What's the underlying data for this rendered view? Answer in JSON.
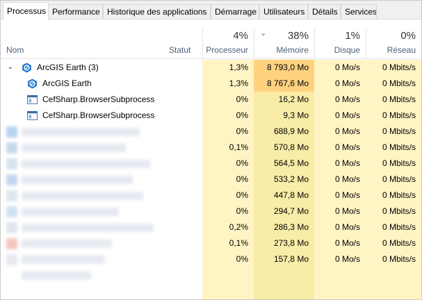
{
  "tabs": [
    {
      "label": "Processus",
      "active": true
    },
    {
      "label": "Performance",
      "active": false
    },
    {
      "label": "Historique des applications",
      "active": false
    },
    {
      "label": "Démarrage",
      "active": false
    },
    {
      "label": "Utilisateurs",
      "active": false
    },
    {
      "label": "Détails",
      "active": false
    },
    {
      "label": "Services",
      "active": false
    }
  ],
  "columns": {
    "name": {
      "label": "Nom"
    },
    "status": {
      "label": "Statut"
    },
    "cpu": {
      "label": "Processeur",
      "total": "4%"
    },
    "memory": {
      "label": "Mémoire",
      "total": "38%",
      "sorted": true
    },
    "disk": {
      "label": "Disque",
      "total": "1%"
    },
    "network": {
      "label": "Réseau",
      "total": "0%"
    }
  },
  "colors": {
    "heat_light": "#fff4c4",
    "heat_medium": "#f9eca8",
    "heat_strong": "#ffd280",
    "header_label": "#4c607a",
    "arcgis_blue": "#1f77d0"
  },
  "rows": [
    {
      "name": "ArcGIS Earth (3)",
      "group": true,
      "expanded": true,
      "icon": "arcgis-earth-icon",
      "cpu": "1,3%",
      "memory": "8 793,0 Mo",
      "disk": "0 Mo/s",
      "network": "0 Mbits/s"
    },
    {
      "name": "ArcGIS Earth",
      "child": true,
      "icon": "arcgis-earth-icon",
      "cpu": "1,3%",
      "memory": "8 767,6 Mo",
      "disk": "0 Mo/s",
      "network": "0 Mbits/s"
    },
    {
      "name": "CefSharp.BrowserSubprocess",
      "child": true,
      "icon": "window-app-icon",
      "cpu": "0%",
      "memory": "16,2 Mo",
      "disk": "0 Mo/s",
      "network": "0 Mbits/s"
    },
    {
      "name": "CefSharp.BrowserSubprocess",
      "child": true,
      "icon": "window-app-icon",
      "cpu": "0%",
      "memory": "9,3 Mo",
      "disk": "0 Mo/s",
      "network": "0 Mbits/s"
    },
    {
      "name": "",
      "blurred": true,
      "cpu": "0%",
      "memory": "688,9 Mo",
      "disk": "0 Mo/s",
      "network": "0 Mbits/s"
    },
    {
      "name": "",
      "blurred": true,
      "cpu": "0,1%",
      "memory": "570,8 Mo",
      "disk": "0 Mo/s",
      "network": "0 Mbits/s"
    },
    {
      "name": "",
      "blurred": true,
      "cpu": "0%",
      "memory": "564,5 Mo",
      "disk": "0 Mo/s",
      "network": "0 Mbits/s"
    },
    {
      "name": "",
      "blurred": true,
      "cpu": "0%",
      "memory": "533,2 Mo",
      "disk": "0 Mo/s",
      "network": "0 Mbits/s"
    },
    {
      "name": "",
      "blurred": true,
      "cpu": "0%",
      "memory": "447,8 Mo",
      "disk": "0 Mo/s",
      "network": "0 Mbits/s"
    },
    {
      "name": "",
      "blurred": true,
      "cpu": "0%",
      "memory": "294,7 Mo",
      "disk": "0 Mo/s",
      "network": "0 Mbits/s"
    },
    {
      "name": "",
      "blurred": true,
      "cpu": "0,2%",
      "memory": "286,3 Mo",
      "disk": "0 Mo/s",
      "network": "0 Mbits/s"
    },
    {
      "name": "",
      "blurred": true,
      "cpu": "0,1%",
      "memory": "273,8 Mo",
      "disk": "0 Mo/s",
      "network": "0 Mbits/s"
    },
    {
      "name": "",
      "blurred": true,
      "cpu": "0%",
      "memory": "157,8 Mo",
      "disk": "0 Mo/s",
      "network": "0 Mbits/s"
    }
  ]
}
